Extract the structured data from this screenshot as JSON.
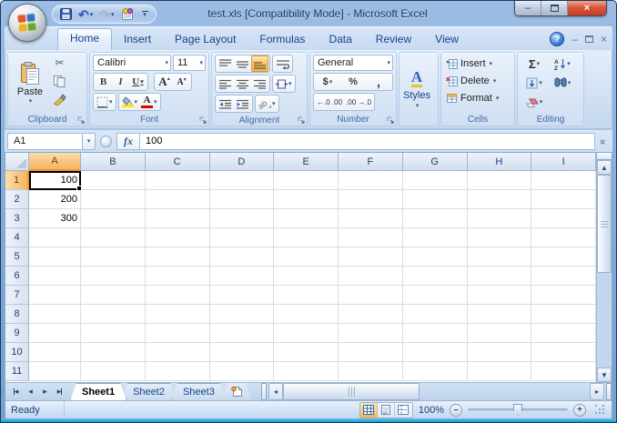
{
  "window": {
    "title": "test.xls  [Compatibility Mode] - Microsoft Excel"
  },
  "icons": {
    "dropdown": "▾",
    "undo": "↶",
    "redo": "↷",
    "minimize": "–",
    "close": "×",
    "help": "?",
    "scissors": "✂",
    "sum": "Σ",
    "expand_formula_bar": "»",
    "nav_first": "◂",
    "nav_prev": "◂",
    "nav_next": "▸",
    "nav_last": "▸",
    "scroll_up": "▲",
    "scroll_down": "▼",
    "scroll_left": "◂",
    "scroll_right": "▸",
    "zoom_out": "–",
    "zoom_in": "+"
  },
  "ribbon": {
    "tabs": [
      {
        "label": "Home",
        "active": true
      },
      {
        "label": "Insert"
      },
      {
        "label": "Page Layout"
      },
      {
        "label": "Formulas"
      },
      {
        "label": "Data"
      },
      {
        "label": "Review"
      },
      {
        "label": "View"
      }
    ],
    "groups": {
      "clipboard": {
        "label": "Clipboard",
        "paste": "Paste"
      },
      "font": {
        "label": "Font",
        "font_name": "Calibri",
        "font_size": "11",
        "bold": "B",
        "italic": "I",
        "underline": "U"
      },
      "alignment": {
        "label": "Alignment"
      },
      "number": {
        "label": "Number",
        "format": "General",
        "currency": "$",
        "percent": "%",
        "comma": ",",
        "increase_decimal": "←.0 .00",
        "decrease_decimal": ".00 →.0"
      },
      "styles": {
        "button_label": "Styles"
      },
      "cells": {
        "label": "Cells",
        "insert": "Insert",
        "delete": "Delete",
        "format": "Format"
      },
      "editing": {
        "label": "Editing"
      }
    }
  },
  "formula_bar": {
    "name_box": "A1",
    "fx_label": "fx",
    "value": "100"
  },
  "grid": {
    "columns": [
      "A",
      "B",
      "C",
      "D",
      "E",
      "F",
      "G",
      "H",
      "I"
    ],
    "row_count": 11,
    "cells": {
      "A1": "100",
      "A2": "200",
      "A3": "300"
    },
    "selected_cell": "A1"
  },
  "sheets": {
    "tabs": [
      {
        "label": "Sheet1",
        "active": true
      },
      {
        "label": "Sheet2"
      },
      {
        "label": "Sheet3"
      }
    ]
  },
  "status": {
    "mode": "Ready",
    "zoom": "100%"
  },
  "colors": {
    "selection_highlight": "#f5b55f",
    "active_button_orange": "#f8b540",
    "header_text_blue": "#15428b",
    "frame_blue": "#7ea7d8",
    "bottom_accent_cyan": "#1fb6e6",
    "close_button_red": "#c03c22"
  }
}
